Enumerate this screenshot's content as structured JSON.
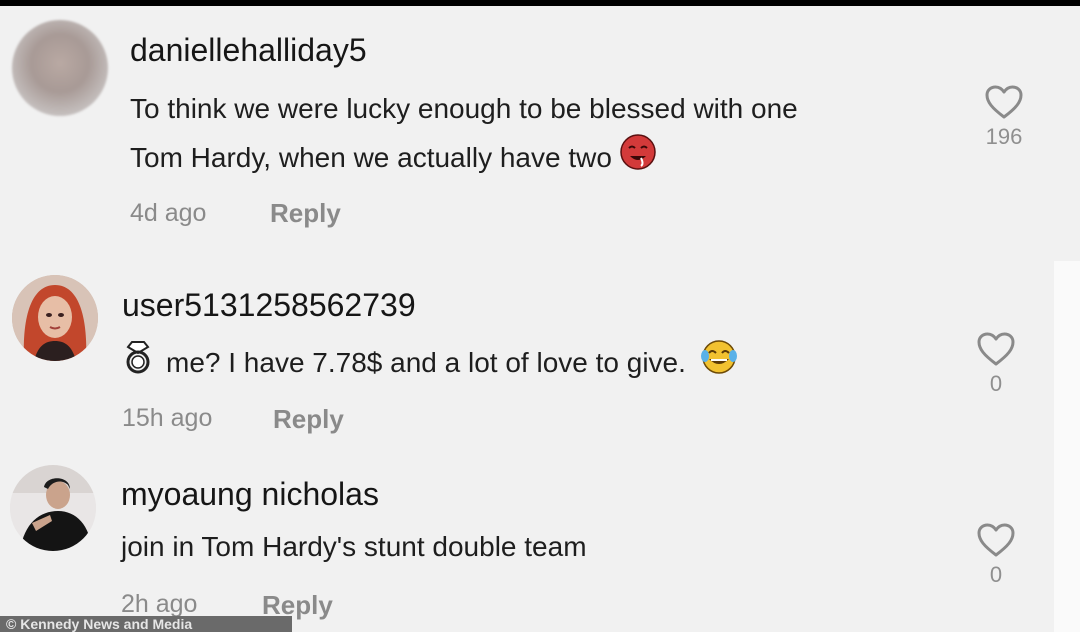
{
  "comments": [
    {
      "username": "daniellehalliday5",
      "text_line1": "To think we were lucky enough to be blessed with one",
      "text_line2": "Tom Hardy, when we actually have two",
      "emoji": "drooling-face",
      "time": "4d ago",
      "reply": "Reply",
      "likes": "196"
    },
    {
      "username": "user5131258562739",
      "text_prefix_icon": "ring",
      "text_line1": "me? I have 7.78$ and a lot of love to give.",
      "emoji": "tears-of-joy-face",
      "time": "15h ago",
      "reply": "Reply",
      "likes": "0"
    },
    {
      "username": "myoaung nicholas",
      "text_line1": "join in Tom Hardy's stunt double team",
      "time": "2h ago",
      "reply": "Reply",
      "likes": "0"
    }
  ],
  "watermark": "© Kennedy News and Media",
  "colors": {
    "background": "#f1f1f1",
    "username": "#161616",
    "meta": "#8a8a8a"
  }
}
